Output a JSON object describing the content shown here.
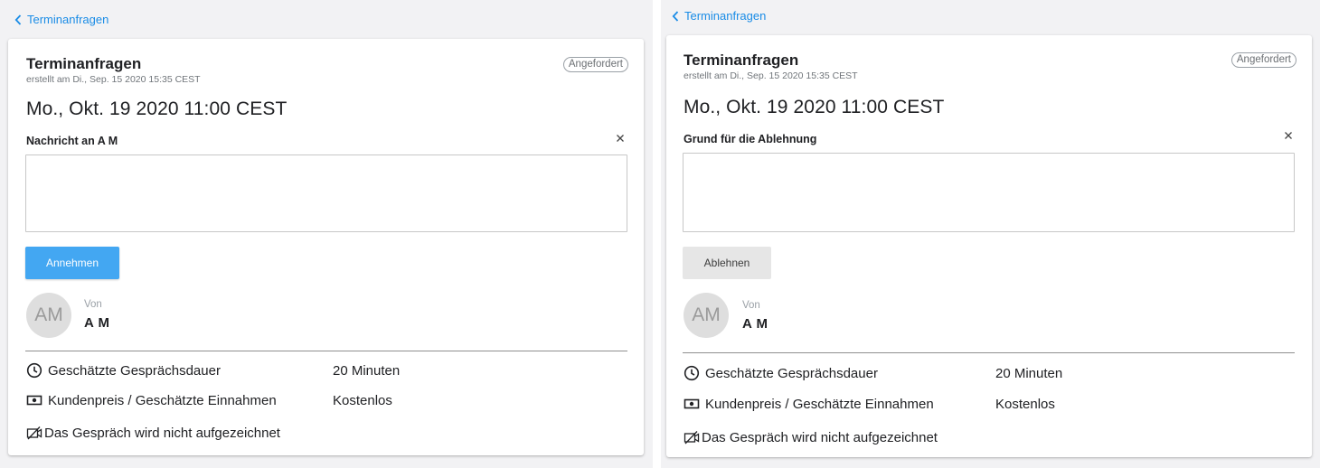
{
  "panels": [
    {
      "back_label": "Terminanfragen",
      "title": "Terminanfragen",
      "created": "erstellt am Di., Sep. 15 2020 15:35 CEST",
      "status": "Angefordert",
      "date": "Mo., Okt. 19 2020 11:00 CEST",
      "field_label": "Nachricht an A M",
      "textarea_value": "",
      "button_label": "Annehmen",
      "avatar_initials": "AM",
      "from_label": "Von",
      "from_name": "A M",
      "duration_label": "Geschätzte Gesprächsdauer",
      "duration_value": "20 Minuten",
      "price_label": "Kundenpreis / Geschätzte Einnahmen",
      "price_value": "Kostenlos",
      "recording_label": "Das Gespräch wird nicht aufgezeichnet"
    },
    {
      "back_label": "Terminanfragen",
      "title": "Terminanfragen",
      "created": "erstellt am Di., Sep. 15 2020 15:35 CEST",
      "status": "Angefordert",
      "date": "Mo., Okt. 19 2020 11:00 CEST",
      "field_label": "Grund für die Ablehnung",
      "textarea_value": "",
      "button_label": "Ablehnen",
      "avatar_initials": "AM",
      "from_label": "Von",
      "from_name": "A M",
      "duration_label": "Geschätzte Gesprächsdauer",
      "duration_value": "20 Minuten",
      "price_label": "Kundenpreis / Geschätzte Einnahmen",
      "price_value": "Kostenlos",
      "recording_label": "Das Gespräch wird nicht aufgezeichnet"
    }
  ],
  "icons": {
    "back": "chevron-left-icon",
    "close": "close-icon",
    "duration": "clock-icon",
    "price": "banknote-icon",
    "recording": "video-off-icon"
  },
  "colors": {
    "link": "#1a8ce6",
    "primary_button": "#43a7f2",
    "secondary_button": "#e6e6e6",
    "background": "#f2f2f4"
  }
}
